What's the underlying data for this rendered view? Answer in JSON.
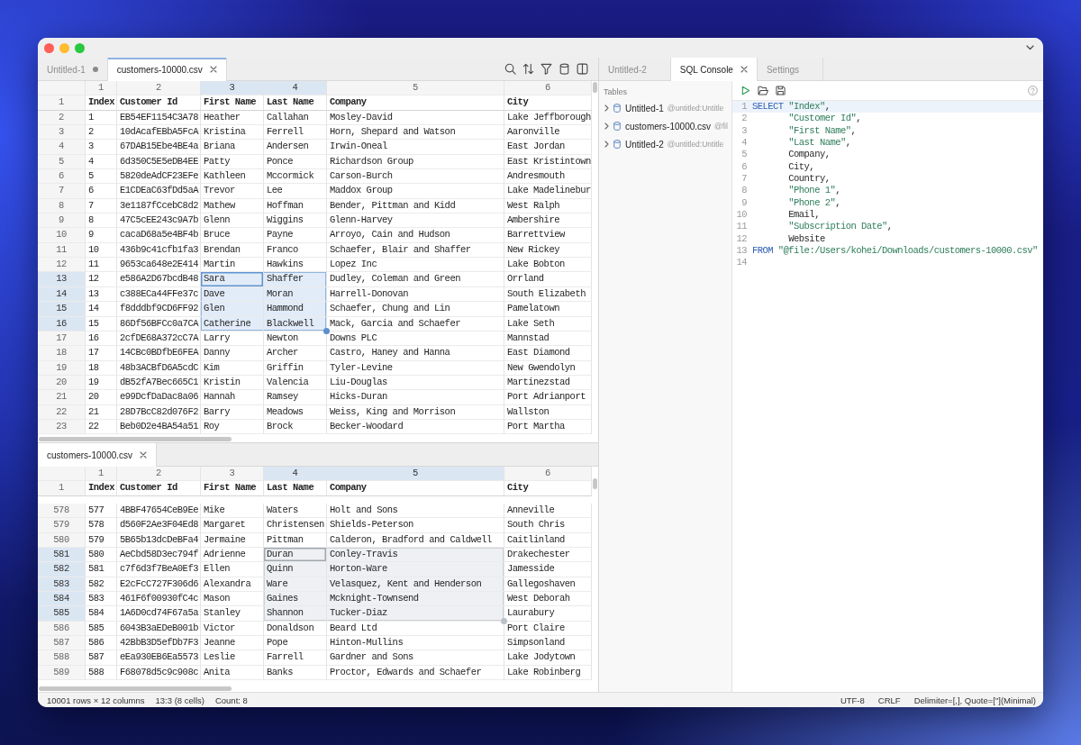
{
  "left_pane": {
    "top": {
      "focused": true,
      "tabs": [
        {
          "label": "Untitled-1",
          "selected": false,
          "modified": true
        },
        {
          "label": "customers-10000.csv",
          "selected": true,
          "modified": false
        }
      ],
      "grid": {
        "columns": [
          {
            "number": "1",
            "selected": false
          },
          {
            "number": "2",
            "selected": false
          },
          {
            "number": "3",
            "selected": true
          },
          {
            "number": "4",
            "selected": true
          },
          {
            "number": "5",
            "selected": false
          },
          {
            "number": "6",
            "selected": false
          }
        ],
        "header_row": {
          "number": "1",
          "cells": [
            "Index",
            "Customer Id",
            "First Name",
            "Last Name",
            "Company",
            "City"
          ]
        },
        "rows": [
          {
            "number": "2",
            "selected": false,
            "cells": [
              "1",
              "EB54EF1154C3A78",
              "Heather",
              "Callahan",
              "Mosley-David",
              "Lake Jeffborough"
            ]
          },
          {
            "number": "3",
            "selected": false,
            "cells": [
              "2",
              "10dAcafEBbA5FcA",
              "Kristina",
              "Ferrell",
              "Horn, Shepard and Watson",
              "Aaronville"
            ]
          },
          {
            "number": "4",
            "selected": false,
            "cells": [
              "3",
              "67DAB15Ebe4BE4a",
              "Briana",
              "Andersen",
              "Irwin-Oneal",
              "East Jordan"
            ]
          },
          {
            "number": "5",
            "selected": false,
            "cells": [
              "4",
              "6d350C5E5eDB4EE",
              "Patty",
              "Ponce",
              "Richardson Group",
              "East Kristintown"
            ]
          },
          {
            "number": "6",
            "selected": false,
            "cells": [
              "5",
              "5820deAdCF23EFe",
              "Kathleen",
              "Mccormick",
              "Carson-Burch",
              "Andresmouth"
            ]
          },
          {
            "number": "7",
            "selected": false,
            "cells": [
              "6",
              "E1CDEaC63fDd5aA",
              "Trevor",
              "Lee",
              "Maddox Group",
              "Lake Madelinebur"
            ]
          },
          {
            "number": "8",
            "selected": false,
            "cells": [
              "7",
              "3e1187fCcebC8d2",
              "Mathew",
              "Hoffman",
              "Bender, Pittman and Kidd",
              "West Ralph"
            ]
          },
          {
            "number": "9",
            "selected": false,
            "cells": [
              "8",
              "47C5cEE243c9A7b",
              "Glenn",
              "Wiggins",
              "Glenn-Harvey",
              "Ambershire"
            ]
          },
          {
            "number": "10",
            "selected": false,
            "cells": [
              "9",
              "cacaD68a5e4BF4b",
              "Bruce",
              "Payne",
              "Arroyo, Cain and Hudson",
              "Barrettview"
            ]
          },
          {
            "number": "11",
            "selected": false,
            "cells": [
              "10",
              "436b9c41cfb1fa3",
              "Brendan",
              "Franco",
              "Schaefer, Blair and Shaffer",
              "New Rickey"
            ]
          },
          {
            "number": "12",
            "selected": false,
            "cells": [
              "11",
              "9653ca648e2E414",
              "Martin",
              "Hawkins",
              "Lopez Inc",
              "Lake Bobton"
            ]
          },
          {
            "number": "13",
            "selected": true,
            "cells": [
              "12",
              "e586A2D67bcdB48",
              "Sara",
              "Shaffer",
              "Dudley, Coleman and Green",
              "Orrland"
            ]
          },
          {
            "number": "14",
            "selected": true,
            "cells": [
              "13",
              "c388ECa44FFe37c",
              "Dave",
              "Moran",
              "Harrell-Donovan",
              "South Elizabeth"
            ]
          },
          {
            "number": "15",
            "selected": true,
            "cells": [
              "14",
              "f8dddbf9CD6FF92",
              "Glen",
              "Hammond",
              "Schaefer, Chung and Lin",
              "Pamelatown"
            ]
          },
          {
            "number": "16",
            "selected": true,
            "cells": [
              "15",
              "86Df56BFCc0a7CA",
              "Catherine",
              "Blackwell",
              "Mack, Garcia and Schaefer",
              "Lake Seth"
            ]
          },
          {
            "number": "17",
            "selected": false,
            "cells": [
              "16",
              "2cfDE68A372cC7A",
              "Larry",
              "Newton",
              "Downs PLC",
              "Mannstad"
            ]
          },
          {
            "number": "18",
            "selected": false,
            "cells": [
              "17",
              "14CBc0BDfbE6FEA",
              "Danny",
              "Archer",
              "Castro, Haney and Hanna",
              "East Diamond"
            ]
          },
          {
            "number": "19",
            "selected": false,
            "cells": [
              "18",
              "48b3ACBfD6A5cdC",
              "Kim",
              "Griffin",
              "Tyler-Levine",
              "New Gwendolyn"
            ]
          },
          {
            "number": "20",
            "selected": false,
            "cells": [
              "19",
              "dB52fA7Bec665C1",
              "Kristin",
              "Valencia",
              "Liu-Douglas",
              "Martinezstad"
            ]
          },
          {
            "number": "21",
            "selected": false,
            "cells": [
              "20",
              "e99DcfDaDac8a06",
              "Hannah",
              "Ramsey",
              "Hicks-Duran",
              "Port Adrianport"
            ]
          },
          {
            "number": "22",
            "selected": false,
            "cells": [
              "21",
              "28D7BcC82d076F2",
              "Barry",
              "Meadows",
              "Weiss, King and Morrison",
              "Wallston"
            ]
          },
          {
            "number": "23",
            "selected": false,
            "cells": [
              "22",
              "Beb0D2e4BA54a51",
              "Roy",
              "Brock",
              "Becker-Woodard",
              "Port Martha"
            ]
          }
        ]
      }
    },
    "bottom": {
      "focused": false,
      "tabs": [
        {
          "label": "customers-10000.csv",
          "selected": true,
          "modified": false
        }
      ],
      "grid": {
        "columns": [
          {
            "number": "1",
            "selected": false
          },
          {
            "number": "2",
            "selected": false
          },
          {
            "number": "3",
            "selected": false
          },
          {
            "number": "4",
            "selected": true
          },
          {
            "number": "5",
            "selected": true
          },
          {
            "number": "6",
            "selected": false
          }
        ],
        "header_row": {
          "number": "1",
          "cells": [
            "Index",
            "Customer Id",
            "First Name",
            "Last Name",
            "Company",
            "City"
          ]
        },
        "rows": [
          {
            "number": "578",
            "selected": false,
            "cells": [
              "577",
              "4BBF47654CeB9Ee",
              "Mike",
              "Waters",
              "Holt and Sons",
              "Anneville"
            ]
          },
          {
            "number": "579",
            "selected": false,
            "cells": [
              "578",
              "d560F2Ae3F04Ed8",
              "Margaret",
              "Christensen",
              "Shields-Peterson",
              "South Chris"
            ]
          },
          {
            "number": "580",
            "selected": false,
            "cells": [
              "579",
              "5B65b13dcDeBFa4",
              "Jermaine",
              "Pittman",
              "Calderon, Bradford and Caldwell",
              "Caitlinland"
            ]
          },
          {
            "number": "581",
            "selected": true,
            "cells": [
              "580",
              "AeCbd58D3ec794f",
              "Adrienne",
              "Duran",
              "Conley-Travis",
              "Drakechester"
            ]
          },
          {
            "number": "582",
            "selected": true,
            "cells": [
              "581",
              "c7f6d3f7BeA0Ef3",
              "Ellen",
              "Quinn",
              "Horton-Ware",
              "Jamesside"
            ]
          },
          {
            "number": "583",
            "selected": true,
            "cells": [
              "582",
              "E2cFcC727F306d6",
              "Alexandra",
              "Ware",
              "Velasquez, Kent and Henderson",
              "Gallegoshaven"
            ]
          },
          {
            "number": "584",
            "selected": true,
            "cells": [
              "583",
              "461F6f00930fC4c",
              "Mason",
              "Gaines",
              "Mcknight-Townsend",
              "West Deborah"
            ]
          },
          {
            "number": "585",
            "selected": true,
            "cells": [
              "584",
              "1A6D0cd74F67a5a",
              "Stanley",
              "Shannon",
              "Tucker-Diaz",
              "Laurabury"
            ]
          },
          {
            "number": "586",
            "selected": false,
            "cells": [
              "585",
              "6043B3aEDeB001b",
              "Victor",
              "Donaldson",
              "Beard Ltd",
              "Port Claire"
            ]
          },
          {
            "number": "587",
            "selected": false,
            "cells": [
              "586",
              "42BbB3D5efDb7F3",
              "Jeanne",
              "Pope",
              "Hinton-Mullins",
              "Simpsonland"
            ]
          },
          {
            "number": "588",
            "selected": false,
            "cells": [
              "587",
              "eEa930EB6Ea5573",
              "Leslie",
              "Farrell",
              "Gardner and Sons",
              "Lake Jodytown"
            ]
          },
          {
            "number": "589",
            "selected": false,
            "cells": [
              "588",
              "F68078d5c9c908c",
              "Anita",
              "Banks",
              "Proctor, Edwards and Schaefer",
              "Lake Robinberg"
            ]
          }
        ]
      }
    }
  },
  "right_pane": {
    "focused": false,
    "tabs": [
      {
        "label": "Untitled-2",
        "selected": false,
        "modified": false
      },
      {
        "label": "SQL Console",
        "selected": true,
        "modified": false
      },
      {
        "label": "Settings",
        "selected": false,
        "modified": false
      }
    ],
    "tables_panel": {
      "title": "Tables",
      "items": [
        {
          "name": "Untitled-1",
          "source": "@untitled:Untitle",
          "expanded": false
        },
        {
          "name": "customers-10000.csv",
          "source": "@fil",
          "expanded": false
        },
        {
          "name": "Untitled-2",
          "source": "@untitled:Untitle",
          "expanded": false
        }
      ]
    },
    "editor": {
      "lines": [
        {
          "number": "1",
          "current": true,
          "tokens": [
            {
              "kind": "keyword",
              "text": "SELECT "
            },
            {
              "kind": "string",
              "text": "\"Index\""
            },
            {
              "kind": "plain",
              "text": ","
            }
          ]
        },
        {
          "number": "2",
          "current": false,
          "tokens": [
            {
              "kind": "string",
              "text": "       \"Customer Id\""
            },
            {
              "kind": "plain",
              "text": ","
            }
          ]
        },
        {
          "number": "3",
          "current": false,
          "tokens": [
            {
              "kind": "string",
              "text": "       \"First Name\""
            },
            {
              "kind": "plain",
              "text": ","
            }
          ]
        },
        {
          "number": "4",
          "current": false,
          "tokens": [
            {
              "kind": "string",
              "text": "       \"Last Name\""
            },
            {
              "kind": "plain",
              "text": ","
            }
          ]
        },
        {
          "number": "5",
          "current": false,
          "tokens": [
            {
              "kind": "plain",
              "text": "       Company,"
            }
          ]
        },
        {
          "number": "6",
          "current": false,
          "tokens": [
            {
              "kind": "plain",
              "text": "       City,"
            }
          ]
        },
        {
          "number": "7",
          "current": false,
          "tokens": [
            {
              "kind": "plain",
              "text": "       Country,"
            }
          ]
        },
        {
          "number": "8",
          "current": false,
          "tokens": [
            {
              "kind": "string",
              "text": "       \"Phone 1\""
            },
            {
              "kind": "plain",
              "text": ","
            }
          ]
        },
        {
          "number": "9",
          "current": false,
          "tokens": [
            {
              "kind": "string",
              "text": "       \"Phone 2\""
            },
            {
              "kind": "plain",
              "text": ","
            }
          ]
        },
        {
          "number": "10",
          "current": false,
          "tokens": [
            {
              "kind": "plain",
              "text": "       Email,"
            }
          ]
        },
        {
          "number": "11",
          "current": false,
          "tokens": [
            {
              "kind": "string",
              "text": "       \"Subscription Date\""
            },
            {
              "kind": "plain",
              "text": ","
            }
          ]
        },
        {
          "number": "12",
          "current": false,
          "tokens": [
            {
              "kind": "plain",
              "text": "       Website"
            }
          ]
        },
        {
          "number": "13",
          "current": false,
          "tokens": [
            {
              "kind": "keyword",
              "text": "FROM "
            },
            {
              "kind": "string",
              "text": "\"@file:/Users/kohei/Downloads/customers-10000.csv\""
            }
          ]
        },
        {
          "number": "14",
          "current": false
        }
      ]
    }
  },
  "status_bar": {
    "left": [
      "10001 rows × 12 columns",
      "13:3 (8 cells)",
      "Count: 8"
    ],
    "right": [
      "UTF-8",
      "CRLF",
      "Delimiter=[,], Quote=[\"](Minimal)"
    ]
  }
}
